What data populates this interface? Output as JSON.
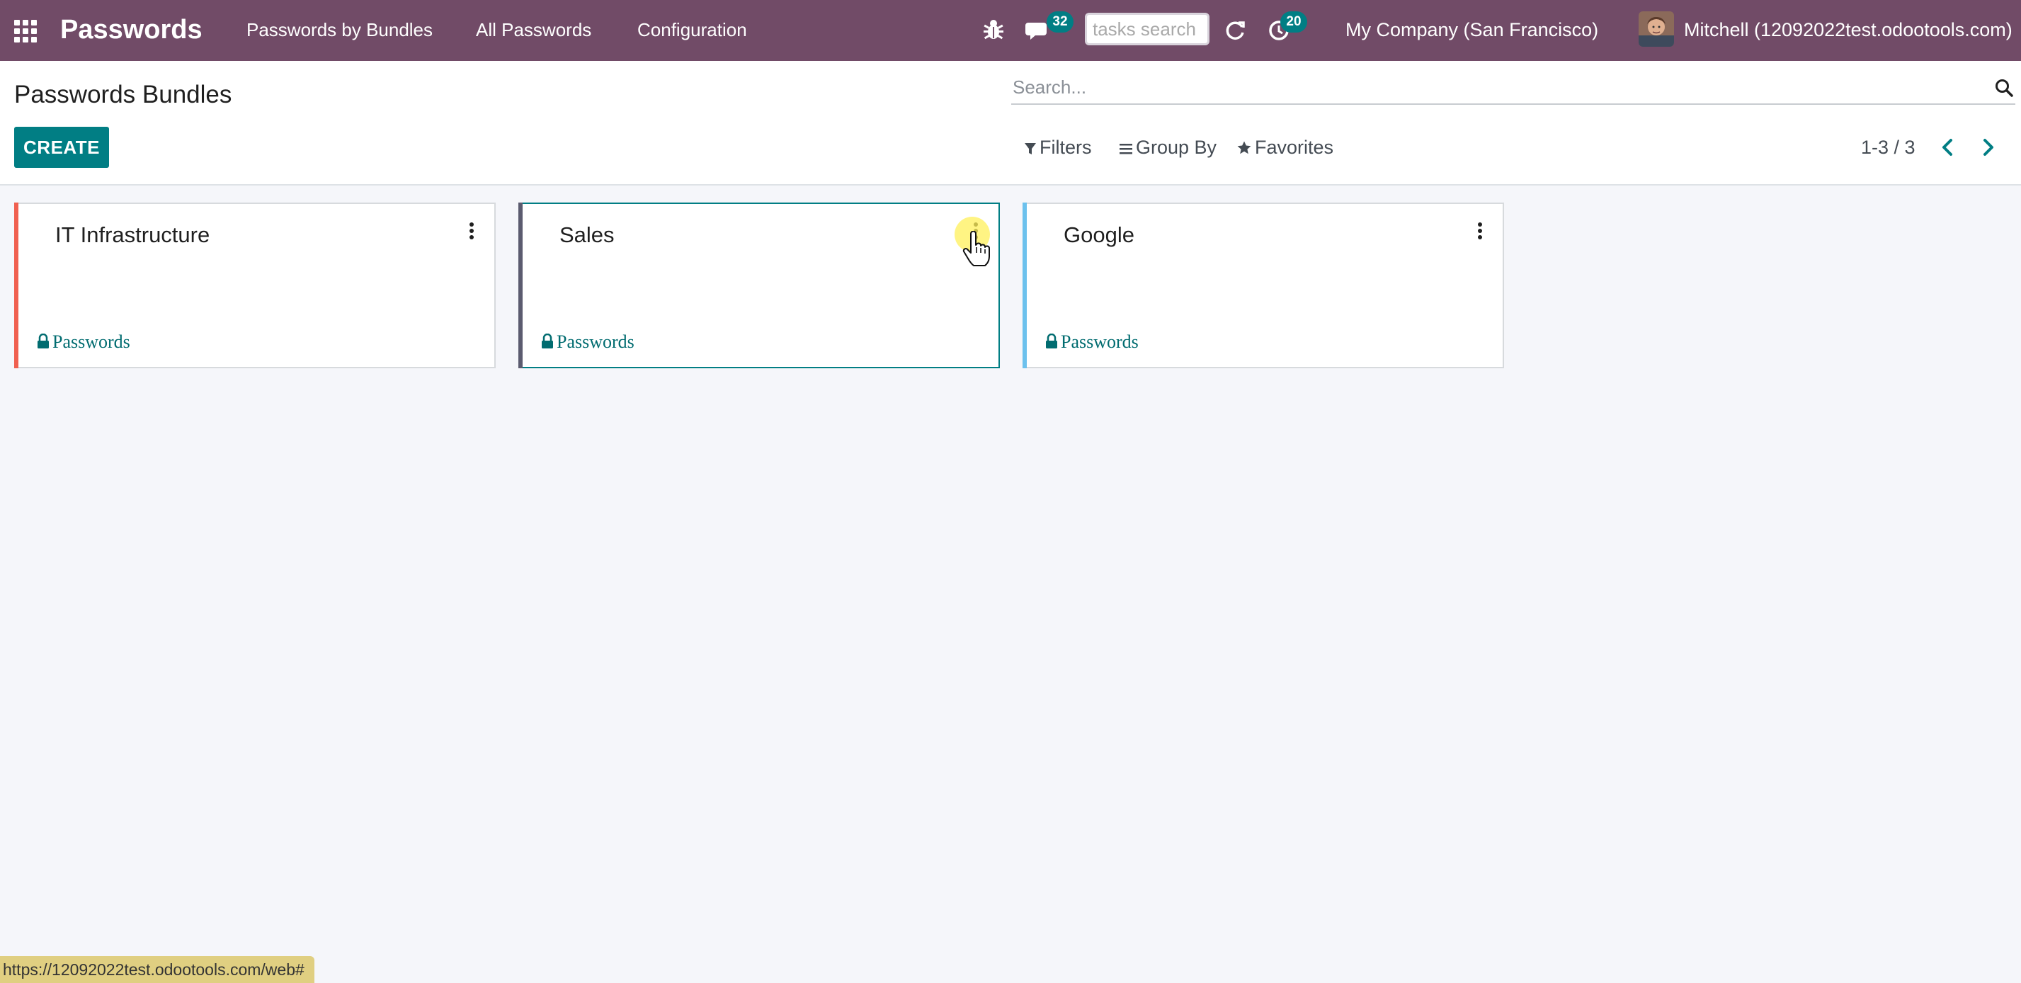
{
  "navbar": {
    "app_title": "Passwords",
    "menus": [
      "Passwords by Bundles",
      "All Passwords",
      "Configuration"
    ],
    "messages_count": "32",
    "activities_count": "20",
    "tasks_search_placeholder": "tasks search",
    "company": "My Company (San Francisco)",
    "user": "Mitchell (12092022test.odootools.com)",
    "icons": [
      "apps-grid-icon",
      "bug-icon",
      "chat-icon",
      "refresh-icon",
      "clock-icon"
    ],
    "background_color": "#714b67"
  },
  "control_panel": {
    "title": "Passwords Bundles",
    "create_label": "CREATE",
    "search_placeholder": "Search...",
    "filters_label": "Filters",
    "group_by_label": "Group By",
    "favorites_label": "Favorites",
    "pager": "1-3 / 3"
  },
  "cards": [
    {
      "title": "IT Infrastructure",
      "link_label": "Passwords",
      "color": "#f06050"
    },
    {
      "title": "Sales",
      "link_label": "Passwords",
      "color": "#5b5b6f"
    },
    {
      "title": "Google",
      "link_label": "Passwords",
      "color": "#6cc1ed"
    }
  ],
  "status_bar": {
    "url": "https://12092022test.odootools.com/web#"
  },
  "accent_color": "#017e84"
}
